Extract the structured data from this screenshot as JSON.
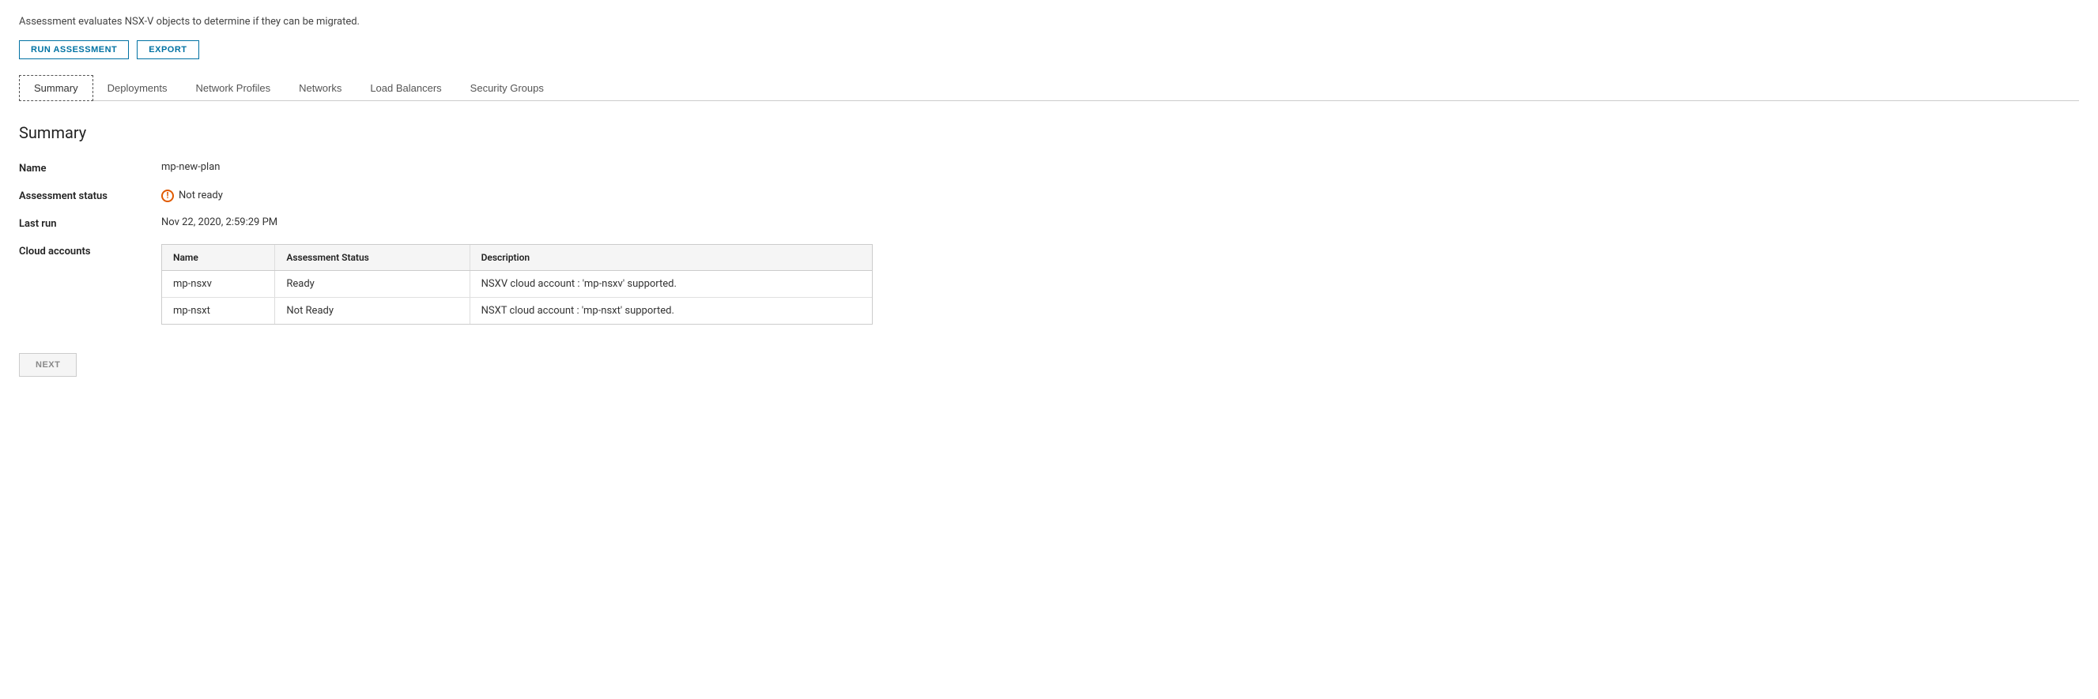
{
  "description": "Assessment evaluates NSX-V objects to determine if they can be migrated.",
  "toolbar": {
    "run_assessment_label": "RUN ASSESSMENT",
    "export_label": "EXPORT"
  },
  "tabs": [
    {
      "id": "summary",
      "label": "Summary",
      "active": true
    },
    {
      "id": "deployments",
      "label": "Deployments",
      "active": false
    },
    {
      "id": "network-profiles",
      "label": "Network Profiles",
      "active": false
    },
    {
      "id": "networks",
      "label": "Networks",
      "active": false
    },
    {
      "id": "load-balancers",
      "label": "Load Balancers",
      "active": false
    },
    {
      "id": "security-groups",
      "label": "Security Groups",
      "active": false
    }
  ],
  "section_title": "Summary",
  "fields": {
    "name_label": "Name",
    "name_value": "mp-new-plan",
    "assessment_status_label": "Assessment status",
    "assessment_status_value": "Not ready",
    "last_run_label": "Last run",
    "last_run_value": "Nov 22, 2020, 2:59:29 PM",
    "cloud_accounts_label": "Cloud accounts"
  },
  "cloud_table": {
    "columns": [
      "Name",
      "Assessment Status",
      "Description"
    ],
    "rows": [
      {
        "name": "mp-nsxv",
        "assessment_status": "Ready",
        "description": "NSXV cloud account : 'mp-nsxv' supported."
      },
      {
        "name": "mp-nsxt",
        "assessment_status": "Not Ready",
        "description": "NSXT cloud account : 'mp-nsxt' supported."
      }
    ]
  },
  "footer": {
    "next_label": "NEXT"
  }
}
